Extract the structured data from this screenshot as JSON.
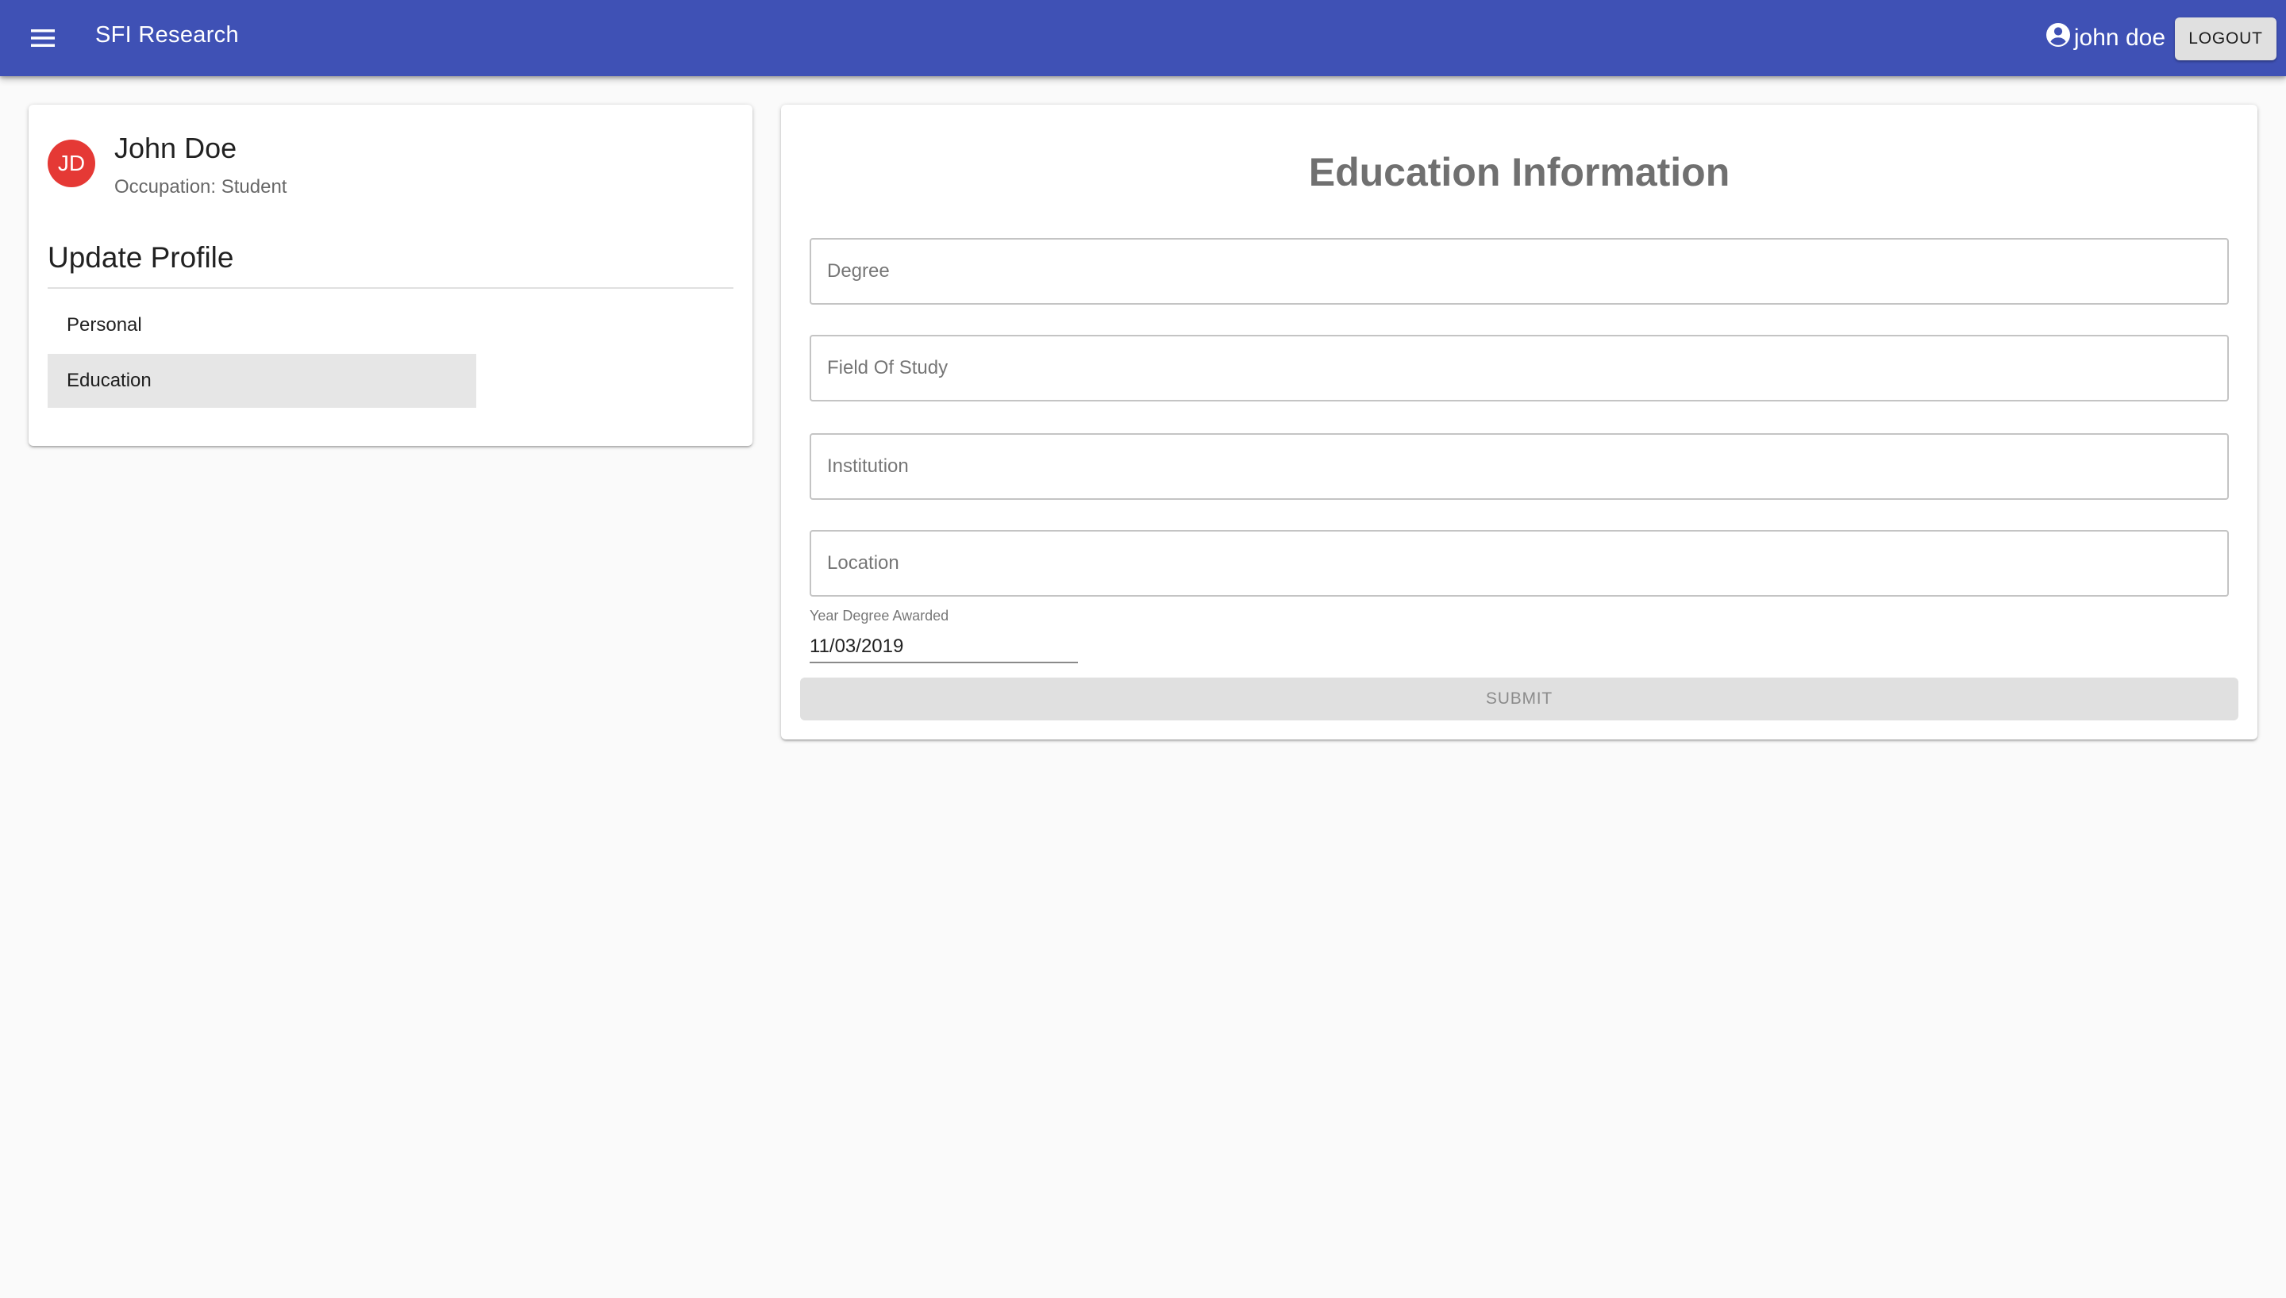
{
  "colors": {
    "app_bar": "#3f51b5",
    "avatar_bg": "#e53935",
    "page_bg": "#fafafa",
    "selected_nav_bg": "#e6e6e6",
    "disabled_button_bg": "#e0e0e0"
  },
  "header": {
    "menu_icon": "hamburger-menu-icon",
    "app_title": "SFI Research",
    "user_icon": "account-circle-icon",
    "user_name": "john doe",
    "logout_label": "LOGOUT"
  },
  "profile": {
    "avatar_initials": "JD",
    "name": "John Doe",
    "occupation": "Occupation: Student",
    "section_title": "Update Profile",
    "nav_items": [
      {
        "label": "Personal",
        "selected": false
      },
      {
        "label": "Education",
        "selected": true
      }
    ]
  },
  "education_form": {
    "title": "Education Information",
    "fields": {
      "degree": {
        "placeholder": "Degree",
        "value": ""
      },
      "field_of_study": {
        "placeholder": "Field Of Study",
        "value": ""
      },
      "institution": {
        "placeholder": "Institution",
        "value": ""
      },
      "location": {
        "placeholder": "Location",
        "value": ""
      }
    },
    "year_label": "Year Degree Awarded",
    "year_value": "11/03/2019",
    "submit_label": "SUBMIT",
    "submit_disabled": true
  }
}
